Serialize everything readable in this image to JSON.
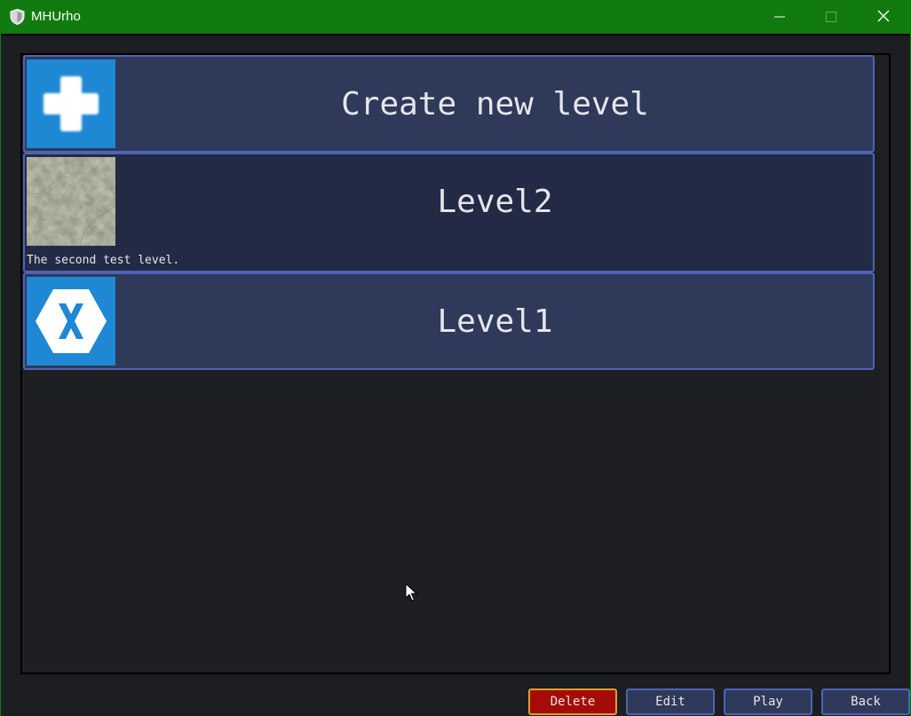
{
  "window": {
    "title": "MHUrho",
    "accent_color": "#117b0f",
    "controls": {
      "minimize_icon": "minimize-icon",
      "maximize_icon": "maximize-icon",
      "close_icon": "close-icon"
    }
  },
  "level_list": {
    "items": [
      {
        "name": "Create new level",
        "description": "",
        "icon": "plus-icon"
      },
      {
        "name": "Level2",
        "description": "The second test level.",
        "icon": "rock-texture-thumbnail"
      },
      {
        "name": "Level1",
        "description": "",
        "icon": "xamarin-logo-icon"
      }
    ],
    "item_border_color": "#4c63b6",
    "item_background": "#2f3959",
    "selected_background": "#232a45"
  },
  "actions": {
    "delete_label": "Delete",
    "edit_label": "Edit",
    "play_label": "Play",
    "back_label": "Back",
    "delete_color": "#a50b07"
  }
}
